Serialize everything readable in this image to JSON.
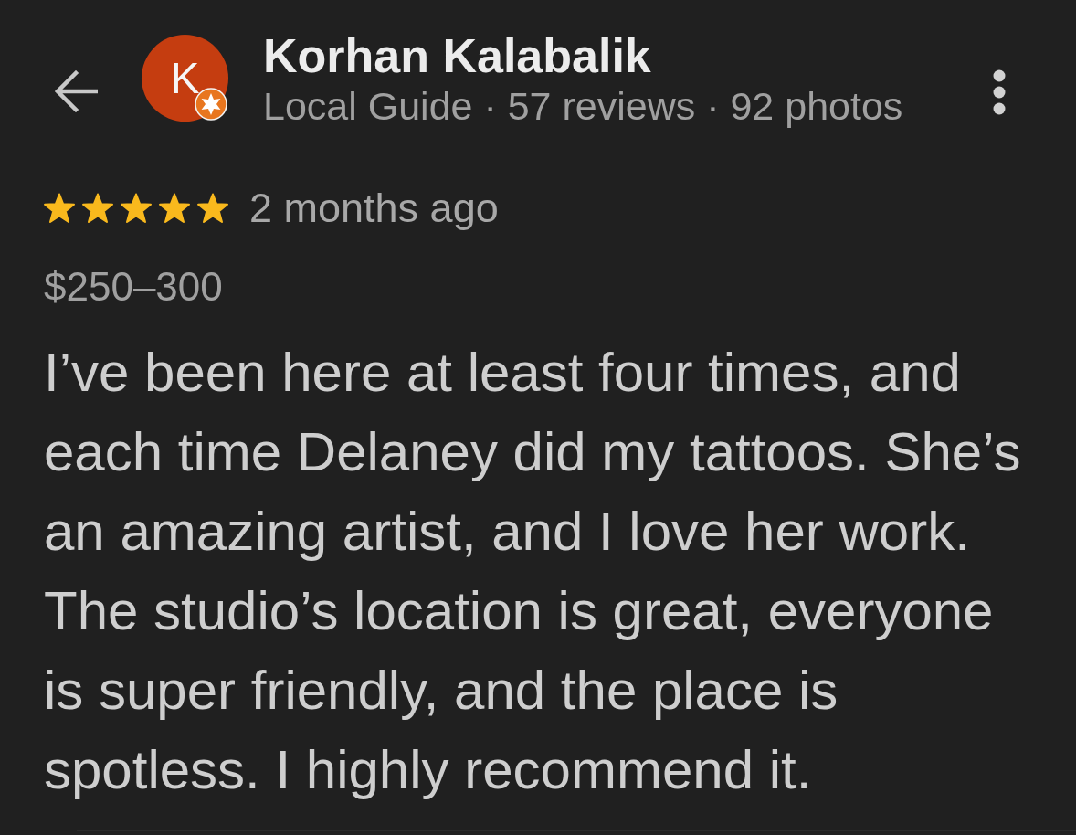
{
  "header": {
    "avatar": {
      "initial": "K"
    },
    "name": "Korhan Kalabalik",
    "meta": "Local Guide · 57 reviews · 92 photos"
  },
  "review": {
    "stars": 5,
    "time": "2 months ago",
    "price": "$250–300",
    "text": "I’ve been here at least four times, and each time Delaney did my tattoos. She’s an amazing artist, and I love her work. The studio’s location is great, everyone is super friendly, and the place is spotless. I highly recommend it."
  }
}
